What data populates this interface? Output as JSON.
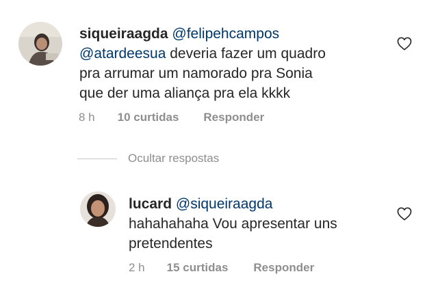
{
  "comments": [
    {
      "username": "siqueiraagda",
      "mention_1": "@felipehcampos",
      "mention_2": "@atardeesua",
      "line_1_rest": "deveria fazer um quadro",
      "line_2": "pra arrumar um namorado pra Sonia",
      "line_3": "que der uma aliança pra ela kkkk",
      "time": "8 h",
      "likes": "10 curtidas",
      "reply": "Responder"
    }
  ],
  "hide_replies": "Ocultar respostas",
  "replies": [
    {
      "username": "lucard",
      "mention": "@siqueiraagda",
      "line_1": "hahahahaha Vou apresentar uns",
      "line_2": "pretendentes",
      "time": "2 h",
      "likes": "15 curtidas",
      "reply": "Responder"
    }
  ],
  "colors": {
    "text": "#262626",
    "mention": "#00376b",
    "muted": "#8e8e8e"
  },
  "icons": [
    "heart-icon",
    "avatar"
  ]
}
